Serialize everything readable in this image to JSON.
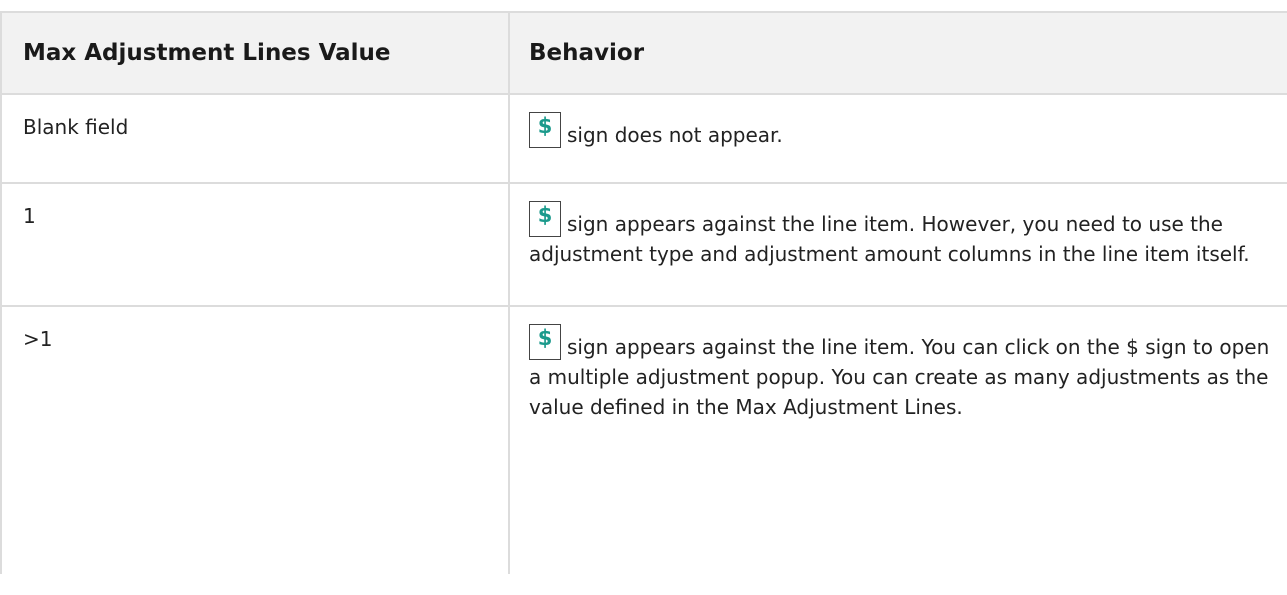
{
  "table": {
    "headers": {
      "value": "Max Adjustment Lines Value",
      "behavior": "Behavior"
    },
    "icon": {
      "name": "dollar-sign-icon",
      "glyph": "$",
      "color": "#1c9a8c"
    },
    "rows": [
      {
        "value": "Blank field",
        "behavior": "sign does not appear."
      },
      {
        "value": "1",
        "behavior": "sign appears against the line item. However, you need to use the adjustment type and adjustment amount columns in the line item itself."
      },
      {
        "value": ">1",
        "behavior": "sign appears against the line item. You can click on the $ sign to open a multiple adjustment popup. You can create as many adjustments as the value defined in the Max Adjustment Lines."
      }
    ]
  }
}
